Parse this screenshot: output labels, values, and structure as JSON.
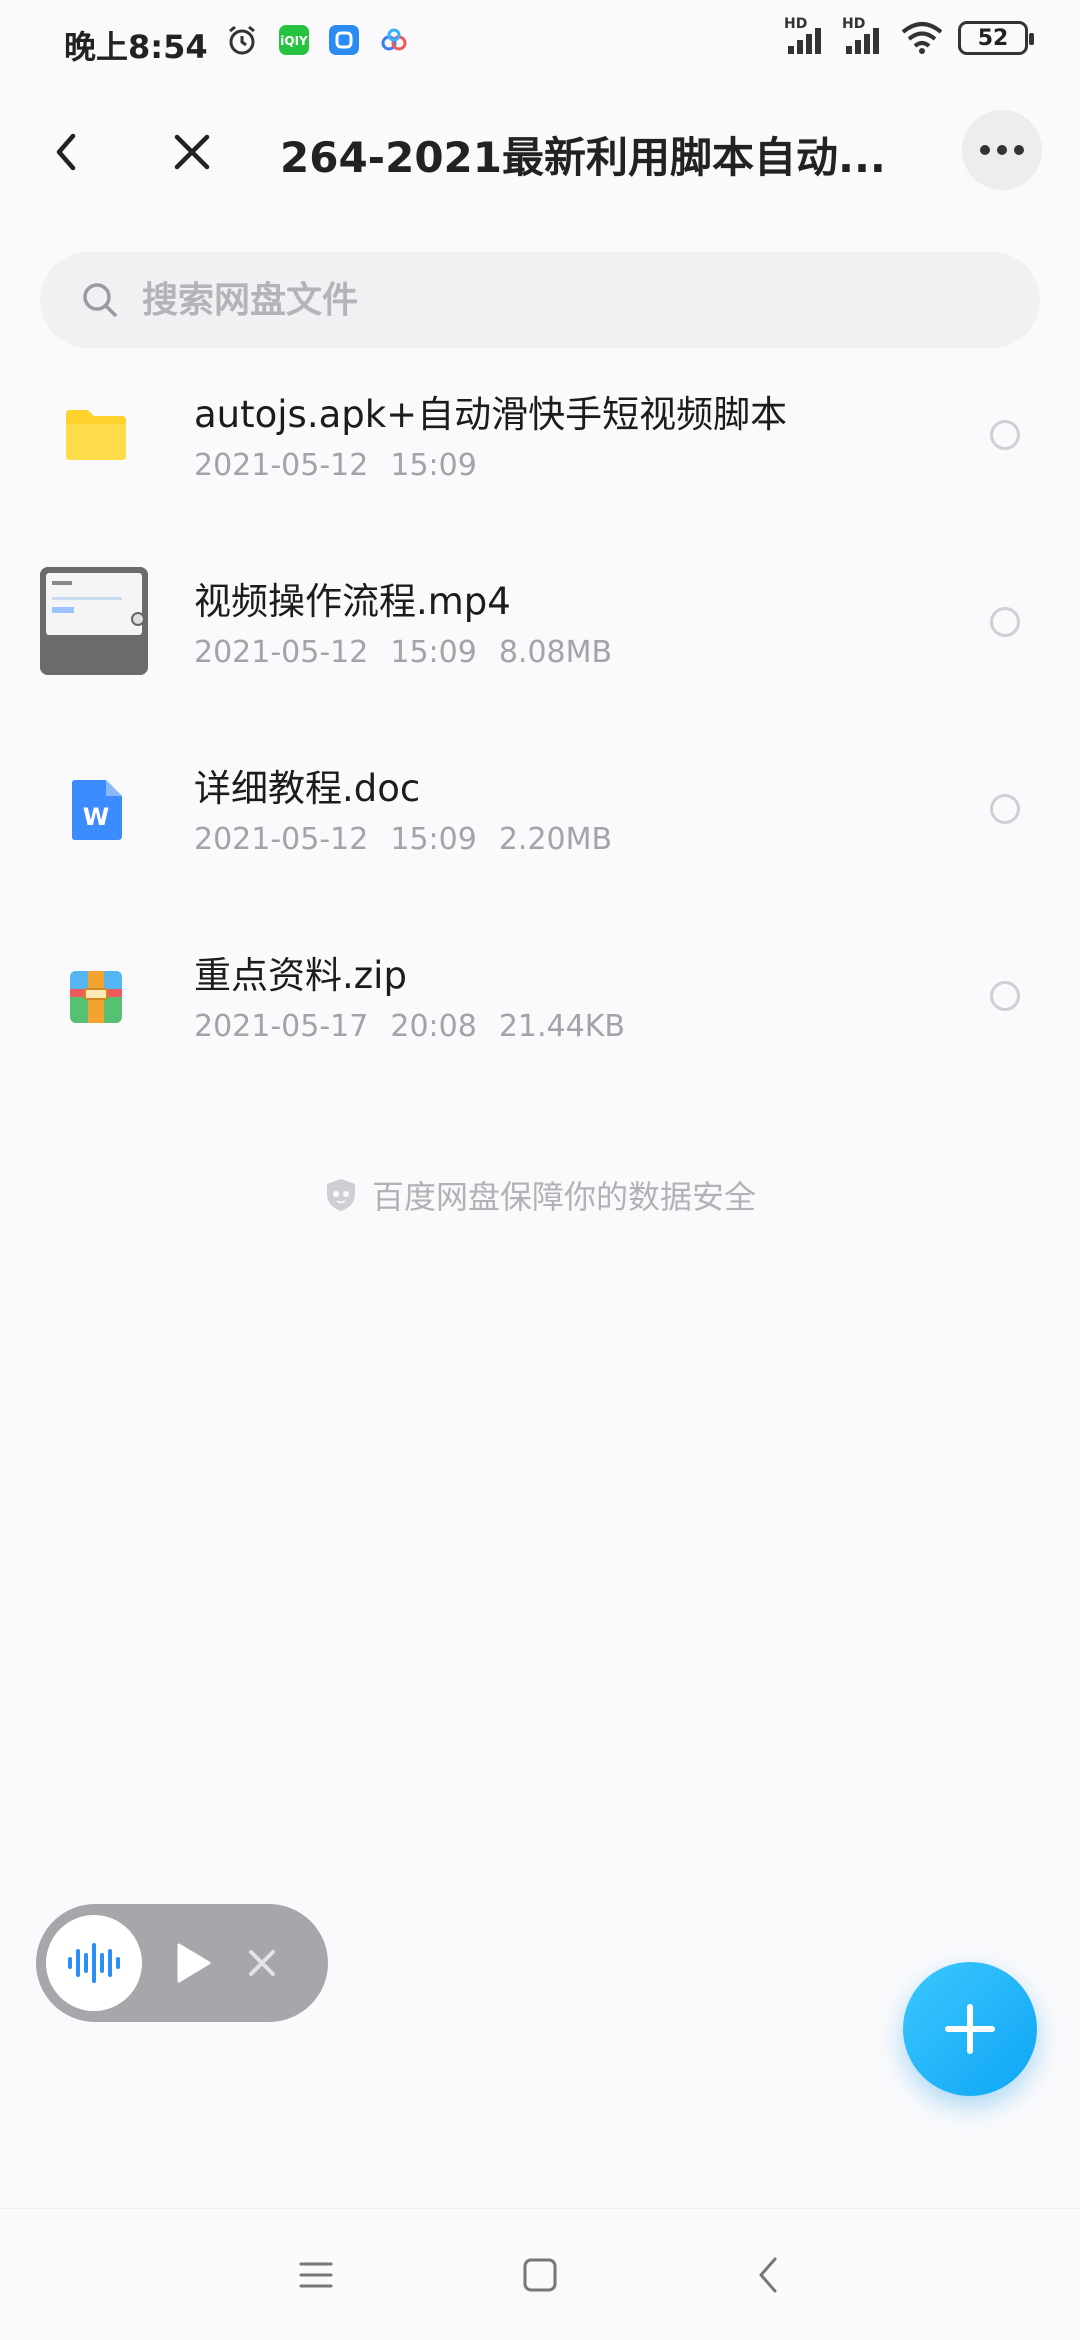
{
  "status_bar": {
    "time": "晚上8:54",
    "battery": "52",
    "icons": [
      "alarm-icon",
      "iqiyi-app-icon",
      "fish-app-icon",
      "baidu-netdisk-app-icon",
      "hd-signal-icon",
      "hd-signal-icon",
      "wifi-icon",
      "battery-icon"
    ],
    "hd_label": "HD"
  },
  "header": {
    "title": "264-2021最新利用脚本自动...",
    "back_icon": "chevron-left-icon",
    "close_icon": "close-icon",
    "more_icon": "more-icon"
  },
  "search": {
    "placeholder": "搜索网盘文件"
  },
  "files": [
    {
      "name": "autojs.apk+自动滑快手短视频脚本",
      "date": "2021-05-12",
      "time": "15:09",
      "size": "",
      "type": "folder"
    },
    {
      "name": "视频操作流程.mp4",
      "date": "2021-05-12",
      "time": "15:09",
      "size": "8.08MB",
      "type": "video"
    },
    {
      "name": "详细教程.doc",
      "date": "2021-05-12",
      "time": "15:09",
      "size": "2.20MB",
      "type": "doc"
    },
    {
      "name": "重点资料.zip",
      "date": "2021-05-17",
      "time": "20:08",
      "size": "21.44KB",
      "type": "zip"
    }
  ],
  "footer_note": "百度网盘保障你的数据安全",
  "colors": {
    "accent": "#0ea5f5",
    "folder": "#ffd22e",
    "doc": "#3c8cff",
    "text_primary": "#1c1c1c",
    "text_secondary": "#a3a3a8"
  }
}
